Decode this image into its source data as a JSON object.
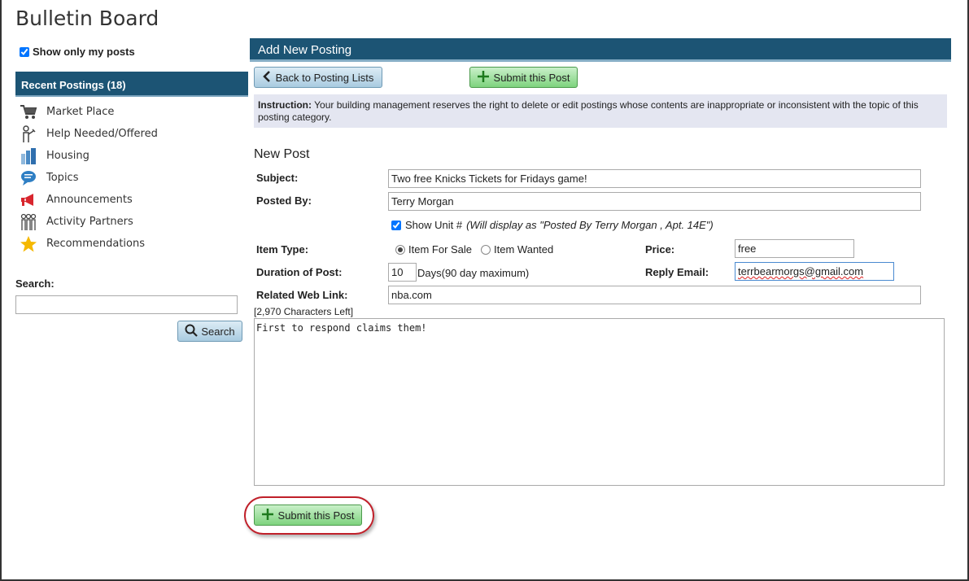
{
  "app": {
    "title": "Bulletin Board"
  },
  "sidebar": {
    "show_only_mine_label": "Show only my posts",
    "show_only_mine_checked": true,
    "recent_header": "Recent Postings (18)",
    "items": [
      {
        "label": "Market Place",
        "icon": "cart-icon"
      },
      {
        "label": "Help Needed/Offered",
        "icon": "helper-person-icon"
      },
      {
        "label": "Housing",
        "icon": "buildings-icon"
      },
      {
        "label": "Topics",
        "icon": "speech-bubble-icon"
      },
      {
        "label": "Announcements",
        "icon": "megaphone-icon"
      },
      {
        "label": "Activity Partners",
        "icon": "people-group-icon"
      },
      {
        "label": "Recommendations",
        "icon": "star-icon"
      }
    ],
    "search_label": "Search:",
    "search_value": "",
    "search_button": "Search"
  },
  "main": {
    "header": "Add New Posting",
    "back_button": "Back to Posting Lists",
    "submit_button": "Submit this Post",
    "instruction_label": "Instruction:",
    "instruction_text": "Your building management reserves the right to delete or edit postings whose contents are inappropriate or inconsistent with the topic of this posting category.",
    "new_post_title": "New Post",
    "form": {
      "subject_label": "Subject:",
      "subject_value": "Two free Knicks Tickets for Fridays game!",
      "posted_by_label": "Posted By:",
      "posted_by_value": "Terry Morgan",
      "show_unit_label": "Show Unit #",
      "show_unit_note": "(Will display as \"Posted By  Terry Morgan , Apt. 14E\")",
      "show_unit_checked": true,
      "item_type_label": "Item Type:",
      "item_for_sale": "Item For Sale",
      "item_wanted": "Item Wanted",
      "item_type_selected": "Item For Sale",
      "price_label": "Price:",
      "price_value": "free",
      "duration_label": "Duration of Post:",
      "duration_value": "10",
      "duration_unit": "Days(90 day maximum)",
      "reply_email_label": "Reply Email:",
      "reply_email_value": "terrbearmorgs@gmail.com",
      "web_link_label": "Related Web Link:",
      "web_link_value": "nba.com",
      "chars_left": "[2,970 Characters Left]",
      "body_value": "First to respond claims them!"
    }
  },
  "colors": {
    "header_bg": "#1c5474",
    "submit_green": "#7ed37e",
    "blue_button": "#a9cbe0",
    "instruction_bg": "#e4e6f1",
    "highlight_ring": "#c0202a"
  }
}
